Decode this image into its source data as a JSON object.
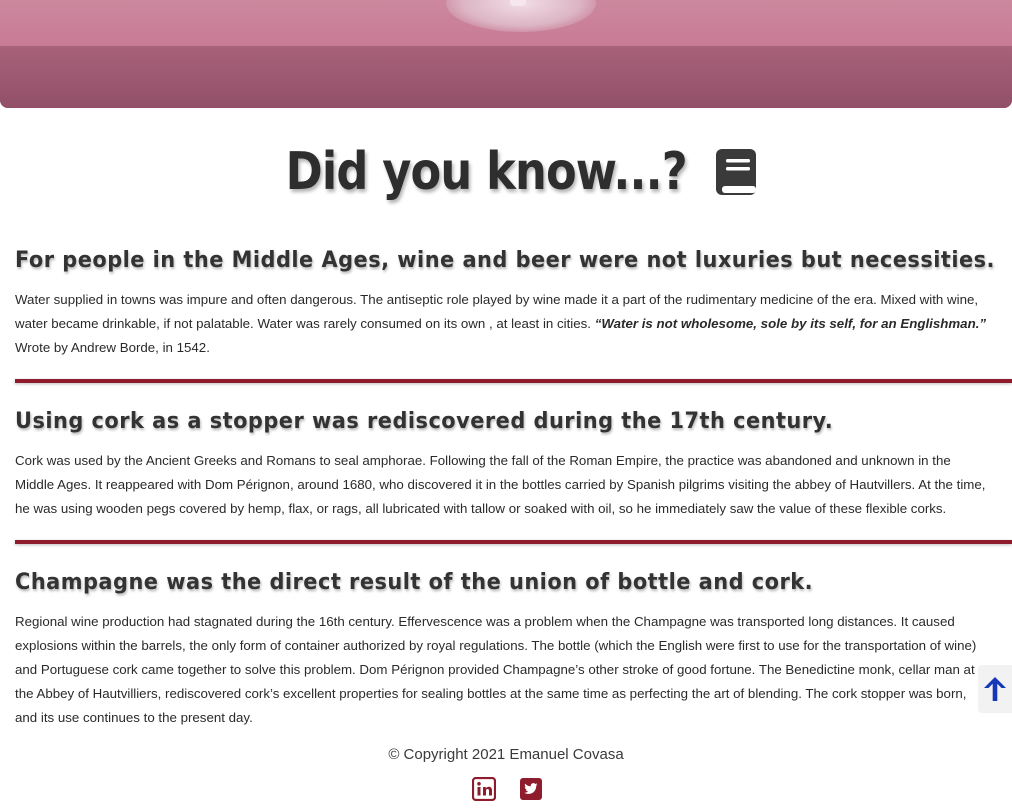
{
  "hero": {
    "image": "wine-glass-photo"
  },
  "heading": {
    "title": "Did you know...?",
    "icon": "book-icon"
  },
  "articles": [
    {
      "title": "For people in the Middle Ages, wine and beer were not luxuries but necessities.",
      "body_before": "Water supplied in towns was impure and often dangerous. The antiseptic role played by wine made it a part of the rudimentary medicine of the era. Mixed with wine, water became drinkable, if not palatable. Water was rarely consumed on its own , at least in cities. ",
      "quote": "“Water is not wholesome, sole by its self, for an Englishman.”",
      "body_after": " Wrote by Andrew Borde, in 1542."
    },
    {
      "title": "Using cork as a stopper was rediscovered during the 17th century.",
      "body": "Cork was used by the Ancient Greeks and Romans to seal amphorae. Following the fall of the Roman Empire, the practice was abandoned and unknown in the Middle Ages. It reappeared with Dom Pérignon, around 1680, who discovered it in the bottles carried by Spanish pilgrims visiting the abbey of Hautvillers. At the time, he was using wooden pegs covered by hemp, flax, or rags, all lubricated with tallow or soaked with oil, so he immediately saw the value of these flexible corks."
    },
    {
      "title": "Champagne was the direct result of the union of bottle and cork.",
      "body": "Regional wine production had stagnated during the 16th century. Effervescence was a problem when the Champagne was transported long distances. It caused explosions within the barrels, the only form of container authorized by royal regulations. The bottle (which the English were first to use for the transportation of wine) and Portuguese cork came together to solve this problem. Dom Pérignon provided Champagne’s other stroke of good fortune. The Benedictine monk, cellar man at the Abbey of Hautvilliers, rediscovered cork’s excellent properties for sealing bottles at the same time as perfecting the art of blending. The cork stopper was born, and its use continues to the present day."
    }
  ],
  "footer": {
    "copyright": "© Copyright 2021 Emanuel Covasa",
    "social": [
      {
        "icon": "linkedin-icon"
      },
      {
        "icon": "twitter-icon"
      }
    ]
  },
  "scroll_top": {
    "icon": "arrow-up-icon"
  },
  "colors": {
    "accent": "#8f1c2c",
    "hero": "#c87a94",
    "text": "#2a2a2a"
  }
}
